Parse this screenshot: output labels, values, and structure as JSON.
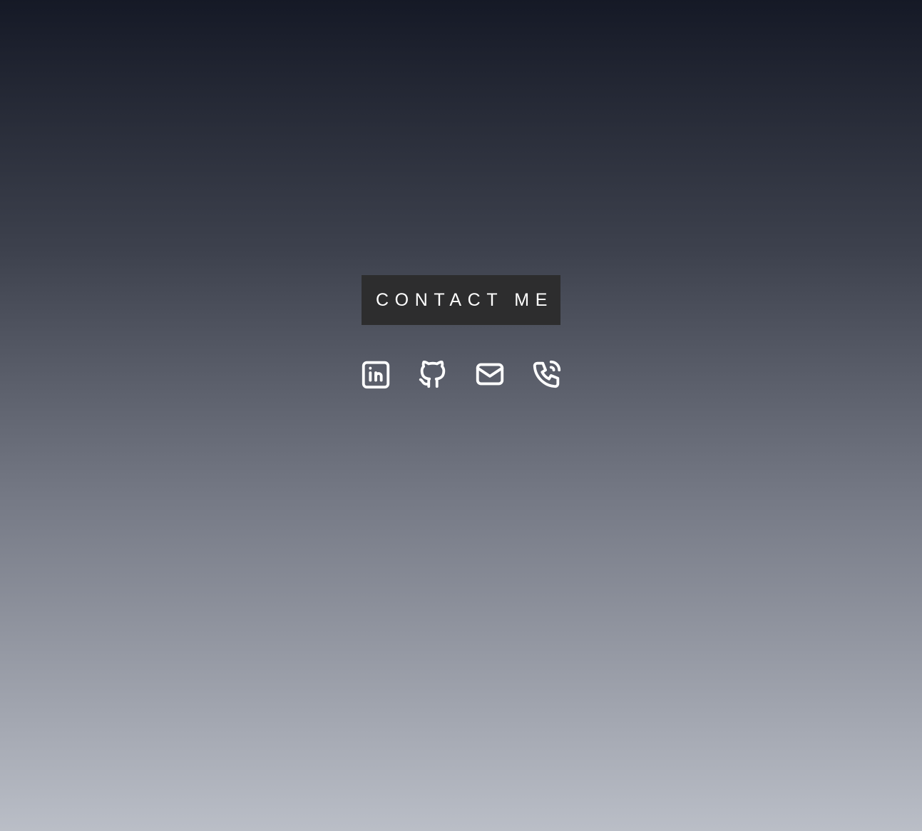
{
  "contact": {
    "heading": "CONTACT ME",
    "icons": [
      "linkedin-icon",
      "github-icon",
      "email-icon",
      "phone-icon"
    ]
  },
  "colors": {
    "heading_bg": "#2d2d2e",
    "heading_text": "#ffffff",
    "icon_stroke": "#ffffff",
    "gradient_top": "#151926",
    "gradient_bottom": "#babec7"
  }
}
